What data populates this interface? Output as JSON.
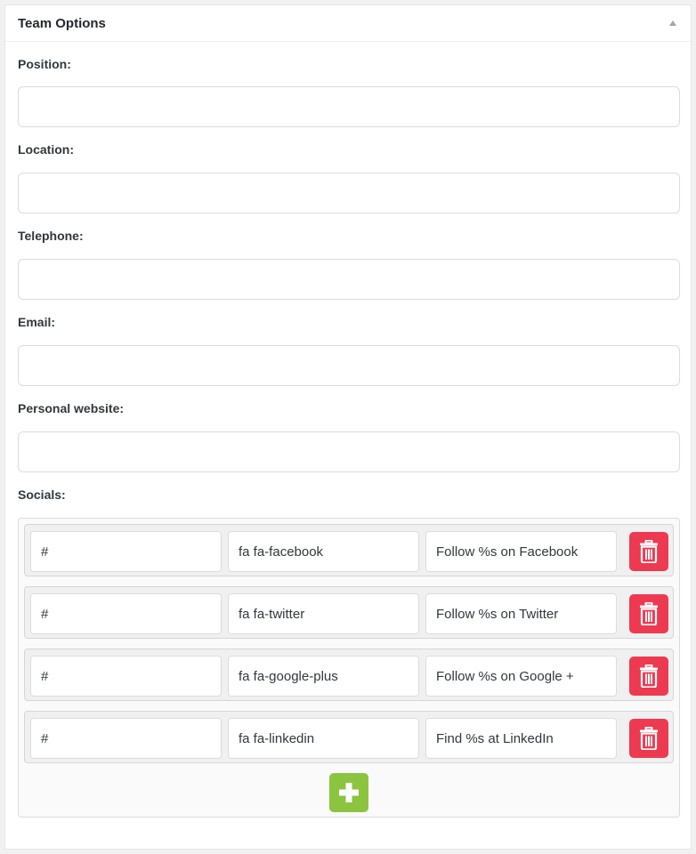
{
  "panel": {
    "title": "Team Options",
    "toggle_icon": "triangle-up-icon"
  },
  "fields": {
    "position": {
      "label": "Position:",
      "value": ""
    },
    "location": {
      "label": "Location:",
      "value": ""
    },
    "telephone": {
      "label": "Telephone:",
      "value": ""
    },
    "email": {
      "label": "Email:",
      "value": ""
    },
    "website": {
      "label": "Personal website:",
      "value": ""
    }
  },
  "socials": {
    "label": "Socials:",
    "rows": [
      {
        "url": "#",
        "icon_class": "fa fa-facebook",
        "title": "Follow %s on Facebook"
      },
      {
        "url": "#",
        "icon_class": "fa fa-twitter",
        "title": "Follow %s on Twitter"
      },
      {
        "url": "#",
        "icon_class": "fa fa-google-plus",
        "title": "Follow %s on Google +"
      },
      {
        "url": "#",
        "icon_class": "fa fa-linkedin",
        "title": "Find %s at LinkedIn"
      }
    ],
    "delete_icon": "trash-icon",
    "add_icon": "plus-icon"
  },
  "colors": {
    "delete": "#ee3a51",
    "add": "#8cc43f"
  }
}
